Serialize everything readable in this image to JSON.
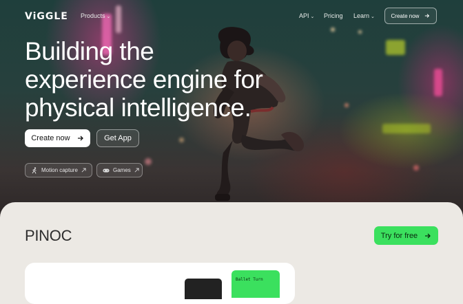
{
  "nav": {
    "logo": "ViGGLE",
    "products": "Products",
    "api": "API",
    "pricing": "Pricing",
    "learn": "Learn",
    "cta": "Create now"
  },
  "hero": {
    "headline_line1": "Building the",
    "headline_line2": "experience engine for",
    "headline_line3": "physical intelligence.",
    "primary_button": "Create now",
    "secondary_button": "Get App",
    "chips": [
      {
        "label": "Motion capture",
        "icon": "running-figure-icon"
      },
      {
        "label": "Games",
        "icon": "gamepad-icon"
      }
    ]
  },
  "product": {
    "title": "PINOC",
    "cta": "Try for free",
    "card_label": "Ballet Turn"
  },
  "colors": {
    "accent_green": "#3be05e",
    "panel_bg": "#ece9e4",
    "hero_tint": "#27403d"
  }
}
